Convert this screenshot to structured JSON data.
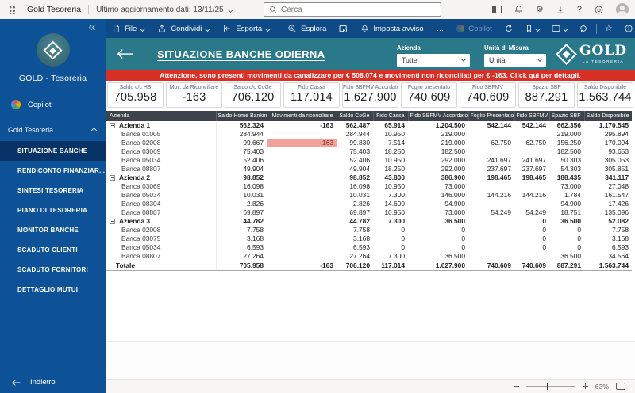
{
  "topbar": {
    "app_name": "Gold Tesoreria",
    "update_label": "Ultimo aggiornamento dati: 13/11/25",
    "search_placeholder": "Cerca"
  },
  "menubar": {
    "file_label": "File",
    "share_label": "Condividi",
    "export_label": "Esporta",
    "explore_label": "Esplora",
    "alert_label": "Imposta avviso",
    "more_label": "…",
    "copilot_label": "Copilot"
  },
  "sidebar": {
    "workspace_title": "GOLD - Tesoreria",
    "copilot_label": "Copilot",
    "group_label": "Gold Tesoreria",
    "items": [
      {
        "label": "SITUAZIONE BANCHE",
        "active": true
      },
      {
        "label": "RENDICONTO FINANZIAR...",
        "active": false
      },
      {
        "label": "SINTESI TESORERIA",
        "active": false
      },
      {
        "label": "PIANO DI TESORERIA",
        "active": false
      },
      {
        "label": "MONITOR BANCHE",
        "active": false
      },
      {
        "label": "SCADUTO CLIENTI",
        "active": false
      },
      {
        "label": "SCADUTO FORNITORI",
        "active": false
      },
      {
        "label": "DETTAGLIO MUTUI",
        "active": false
      }
    ],
    "back_label": "Indietro"
  },
  "header": {
    "title": "SITUAZIONE BANCHE ODIERNA",
    "azienda_label": "Azienda",
    "azienda_value": "Tutte",
    "unita_label": "Unità di Misura",
    "unita_value": "Unità",
    "logo_text": "GOLD",
    "logo_subtext": "LA TESORERIA"
  },
  "alert": {
    "text": "Attenzione, sono presenti movimenti da canalizzare per € 508.074 e movimenti non riconciliati per € -163. Click qui per dettagli."
  },
  "kpis": [
    {
      "label": "Saldo c/c HB",
      "value": "705.958"
    },
    {
      "label": "Mov. da Riconciliare",
      "value": "-163"
    },
    {
      "label": "Saldo c/c CoGe",
      "value": "706.120"
    },
    {
      "label": "Fido Cassa",
      "value": "117.014"
    },
    {
      "label": "Fido SBFMV Accordato",
      "value": "1.627.900"
    },
    {
      "label": "Foglio presentato",
      "value": "740.609"
    },
    {
      "label": "Fido SBFMV",
      "value": "740.609"
    },
    {
      "label": "Spazio SBF",
      "value": "887.291"
    },
    {
      "label": "Saldo Disponibile",
      "value": "1.563.744"
    }
  ],
  "table": {
    "columns": [
      "Azienda",
      "Saldo Home Banking",
      "Movimenti da riconciliare",
      "Saldo CoGe",
      "Fido Cassa",
      "Fido SBFMV Accordato",
      "Foglio Presentato",
      "Fido SBFMV",
      "Spazio SBF",
      "Saldo Disponibile"
    ],
    "rows": [
      {
        "type": "group",
        "name": "Azienda 1",
        "values": [
          "562.324",
          "-163",
          "562.487",
          "65.914",
          "1.204.500",
          "542.144",
          "542.144",
          "662.356",
          "1.170.545"
        ]
      },
      {
        "type": "detail",
        "name": "Banca 01005",
        "values": [
          "284.944",
          "",
          "284.944",
          "10.950",
          "219.000",
          "",
          "",
          "219.000",
          "295.894"
        ]
      },
      {
        "type": "detail",
        "name": "Banca 02008",
        "values": [
          "99.667",
          "-163",
          "99.830",
          "7.514",
          "219.000",
          "62.750",
          "62.750",
          "156.250",
          "170.094"
        ],
        "highlight": 1
      },
      {
        "type": "detail",
        "name": "Banca 03069",
        "values": [
          "75.403",
          "",
          "75.403",
          "18.250",
          "182.500",
          "",
          "",
          "182.500",
          "93.653"
        ]
      },
      {
        "type": "detail",
        "name": "Banca 05034",
        "values": [
          "52.406",
          "",
          "52.406",
          "10.950",
          "292.000",
          "241.697",
          "241.697",
          "50.303",
          "305.053"
        ]
      },
      {
        "type": "detail",
        "name": "Banca 08807",
        "values": [
          "49.904",
          "",
          "49.904",
          "18.250",
          "292.000",
          "237.697",
          "237.697",
          "54.303",
          "305.851"
        ]
      },
      {
        "type": "group",
        "name": "Azienda 2",
        "values": [
          "98.852",
          "",
          "98.852",
          "43.800",
          "386.900",
          "198.465",
          "198.465",
          "188.435",
          "341.117"
        ]
      },
      {
        "type": "detail",
        "name": "Banca 03069",
        "values": [
          "16.098",
          "",
          "16.098",
          "10.950",
          "73.000",
          "",
          "",
          "73.000",
          "27.048"
        ]
      },
      {
        "type": "detail",
        "name": "Banca 05034",
        "values": [
          "10.031",
          "",
          "10.031",
          "7.300",
          "146.000",
          "144.216",
          "144.216",
          "1.784",
          "161.547"
        ]
      },
      {
        "type": "detail",
        "name": "Banca 08304",
        "values": [
          "2.826",
          "",
          "2.826",
          "14.600",
          "94.900",
          "",
          "",
          "94.900",
          "17.426"
        ]
      },
      {
        "type": "detail",
        "name": "Banca 08807",
        "values": [
          "69.897",
          "",
          "69.897",
          "10.950",
          "73.000",
          "54.249",
          "54.249",
          "18.751",
          "135.096"
        ]
      },
      {
        "type": "group",
        "name": "Azienda 3",
        "values": [
          "44.782",
          "",
          "44.782",
          "7.300",
          "36.500",
          "",
          "0",
          "36.500",
          "52.082"
        ]
      },
      {
        "type": "detail",
        "name": "Banca 02008",
        "values": [
          "7.758",
          "",
          "7.758",
          "0",
          "0",
          "",
          "0",
          "0",
          "7.758"
        ]
      },
      {
        "type": "detail",
        "name": "Banca 03075",
        "values": [
          "3.168",
          "",
          "3.168",
          "0",
          "0",
          "",
          "0",
          "0",
          "3.168"
        ]
      },
      {
        "type": "detail",
        "name": "Banca 05034",
        "values": [
          "6.593",
          "",
          "6.593",
          "0",
          "0",
          "",
          "0",
          "0",
          "6.593"
        ]
      },
      {
        "type": "detail",
        "name": "Banca 08807",
        "values": [
          "27.264",
          "",
          "27.264",
          "7.300",
          "36.500",
          "",
          "",
          "36.500",
          "34.564"
        ]
      },
      {
        "type": "total",
        "name": "Totale",
        "values": [
          "705.958",
          "-163",
          "706.120",
          "117.014",
          "1.627.900",
          "740.609",
          "740.609",
          "887.291",
          "1.563.744"
        ]
      }
    ]
  },
  "statusbar": {
    "zoom": "63%"
  },
  "icons": {
    "gear": "⚙",
    "star": "☆",
    "help": "?",
    "more": "…"
  },
  "colors": {
    "sidebar_blue": "#0d5296",
    "sidebar_active": "#073366",
    "menubar_blue": "#0e4a85",
    "header_teal": "#2a798b",
    "alert_red": "#d93025",
    "table_header": "#3c434b",
    "highlight_bg": "#f0a39d",
    "highlight_text": "#93261c"
  }
}
